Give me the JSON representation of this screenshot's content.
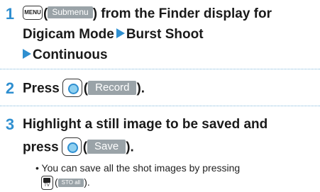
{
  "step1": {
    "number": "1",
    "menu_key": "MENU",
    "softkey": "Submenu",
    "line1_text": ") from the Finder display for",
    "line2_a": "Digicam Mode",
    "line2_b": "Burst Shoot",
    "line3": "Continuous"
  },
  "step2": {
    "number": "2",
    "press_text": "Press",
    "softkey": "Record",
    "close_text": ")."
  },
  "step3": {
    "number": "3",
    "line1": "Highlight a still image to be saved and",
    "press_text": "press",
    "softkey": "Save",
    "close_text": ").",
    "note_line1": "• You can save all the shot images by pressing",
    "note_key_sub": "TV",
    "note_softkey": "STO all",
    "note_close": ")."
  },
  "colors": {
    "accent": "#2f8fd0",
    "softkey_bg": "#9aa3a8",
    "divider": "#7fb7dc"
  }
}
